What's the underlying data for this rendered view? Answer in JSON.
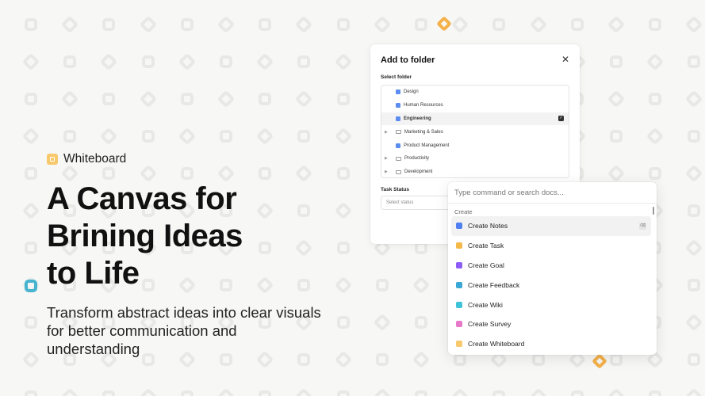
{
  "tag": {
    "label": "Whiteboard",
    "icon": "whiteboard-icon",
    "color": "#f7c86c"
  },
  "hero": {
    "title": "A Canvas for\nBrining Ideas\nto Life",
    "subtitle": "Transform abstract ideas into clear visuals for better communication and understanding"
  },
  "dialog": {
    "title": "Add to folder",
    "close_icon": "close-icon",
    "select_label": "Select folder",
    "folders": [
      {
        "label": "Design",
        "icon": "folder-filled-icon",
        "expandable": false,
        "selected": false
      },
      {
        "label": "Human Resources",
        "icon": "folder-filled-icon",
        "expandable": false,
        "selected": false
      },
      {
        "label": "Engineering",
        "icon": "folder-filled-icon",
        "expandable": false,
        "selected": true
      },
      {
        "label": "Marketing & Sales",
        "icon": "folder-outline-icon",
        "expandable": true,
        "selected": false
      },
      {
        "label": "Product Management",
        "icon": "folder-filled-icon",
        "expandable": false,
        "selected": false
      },
      {
        "label": "Productivity",
        "icon": "folder-outline-icon",
        "expandable": true,
        "selected": false
      },
      {
        "label": "Development",
        "icon": "folder-outline-icon",
        "expandable": true,
        "selected": false
      }
    ],
    "status_label": "Task Status",
    "status_placeholder": "Select status"
  },
  "palette": {
    "search_placeholder": "Type command or search docs...",
    "section": "Create",
    "commands": [
      {
        "label": "Create Notes",
        "color": "#4f7ff0",
        "active": true,
        "shortcut": "⌫"
      },
      {
        "label": "Create Task",
        "color": "#f5b94a",
        "active": false
      },
      {
        "label": "Create Goal",
        "color": "#8b5cf6",
        "active": false
      },
      {
        "label": "Create Feedback",
        "color": "#3aa7d6",
        "active": false
      },
      {
        "label": "Create Wiki",
        "color": "#3fc3d8",
        "active": false
      },
      {
        "label": "Create Survey",
        "color": "#e879c9",
        "active": false
      },
      {
        "label": "Create Whiteboard",
        "color": "#f7c86c",
        "active": false
      }
    ]
  },
  "colors": {
    "accent_orange": "#f5b14a",
    "accent_cyan": "#47b5d0",
    "background": "#f7f7f6"
  }
}
